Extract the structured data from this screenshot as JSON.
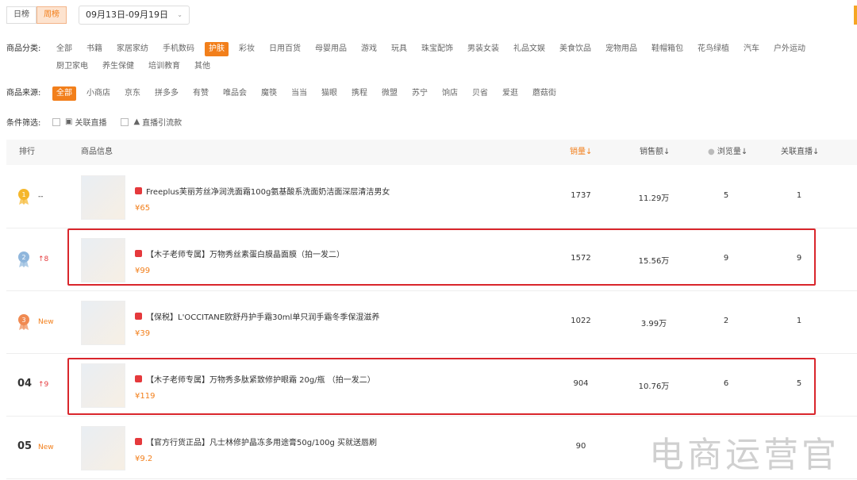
{
  "tabs": [
    {
      "label": "日榜"
    },
    {
      "label": "周榜"
    }
  ],
  "date_range": "09月13日-09月19日",
  "category": {
    "label": "商品分类:",
    "items": [
      "全部",
      "书籍",
      "家居家纺",
      "手机数码",
      "护肤",
      "彩妆",
      "日用百货",
      "母婴用品",
      "游戏",
      "玩具",
      "珠宝配饰",
      "男装女装",
      "礼品文娱",
      "美食饮品",
      "宠物用品",
      "鞋帽箱包",
      "花鸟绿植",
      "汽车",
      "户外运动",
      "厨卫家电",
      "养生保健",
      "培训教育",
      "其他"
    ],
    "active": "护肤"
  },
  "source": {
    "label": "商品来源:",
    "items": [
      "全部",
      "小商店",
      "京东",
      "拼多多",
      "有赞",
      "唯品会",
      "魔筷",
      "当当",
      "猫眼",
      "携程",
      "微盟",
      "苏宁",
      "饷店",
      "贝省",
      "爱逛",
      "蘑菇街"
    ],
    "active": "全部"
  },
  "conditions": {
    "label": "条件筛选:",
    "options": [
      "关联直播",
      "直播引流款"
    ]
  },
  "table": {
    "headers": {
      "rank": "排行",
      "info": "商品信息",
      "sales": "销量↓",
      "revenue": "销售额↓",
      "views": "浏览量↓",
      "live": "关联直播↓"
    },
    "rows": [
      {
        "rank": "1",
        "change": "--",
        "title": "Freeplus芙丽芳丝净润洗面霜100g氨基酸系洗面奶洁面深层清洁男女",
        "price": "¥65",
        "sales": "1737",
        "revenue": "11.29万",
        "views": "5",
        "live": "1"
      },
      {
        "rank": "2",
        "change": "↑8",
        "title": "【木子老师专属】万物秀丝素蛋白膜晶面膜（拍一发二）",
        "price": "¥99",
        "sales": "1572",
        "revenue": "15.56万",
        "views": "9",
        "live": "9"
      },
      {
        "rank": "3",
        "change": "New",
        "title": "【保税】L'OCCITANE欧舒丹护手霜30ml单只润手霜冬季保湿滋养",
        "price": "¥39",
        "sales": "1022",
        "revenue": "3.99万",
        "views": "2",
        "live": "1"
      },
      {
        "rank": "04",
        "change": "↑9",
        "title": "【木子老师专属】万物秀多肽紧致修护眼霜 20g/瓶 （拍一发二）",
        "price": "¥119",
        "sales": "904",
        "revenue": "10.76万",
        "views": "6",
        "live": "5"
      },
      {
        "rank": "05",
        "change": "New",
        "title": "【官方行货正品】凡士林修护晶冻多用途膏50g/100g 买就送唇刷",
        "price": "¥9.2",
        "sales": "90",
        "revenue": "",
        "views": "",
        "live": ""
      }
    ]
  },
  "colors": {
    "accent": "#f27f1b",
    "highlight": "#d9262c",
    "gold": "#f5b72c",
    "silver": "#8fb6dc",
    "bronze": "#f08a52"
  },
  "watermark": {
    "main": "电商运营官",
    "sub": "电商运营官"
  }
}
